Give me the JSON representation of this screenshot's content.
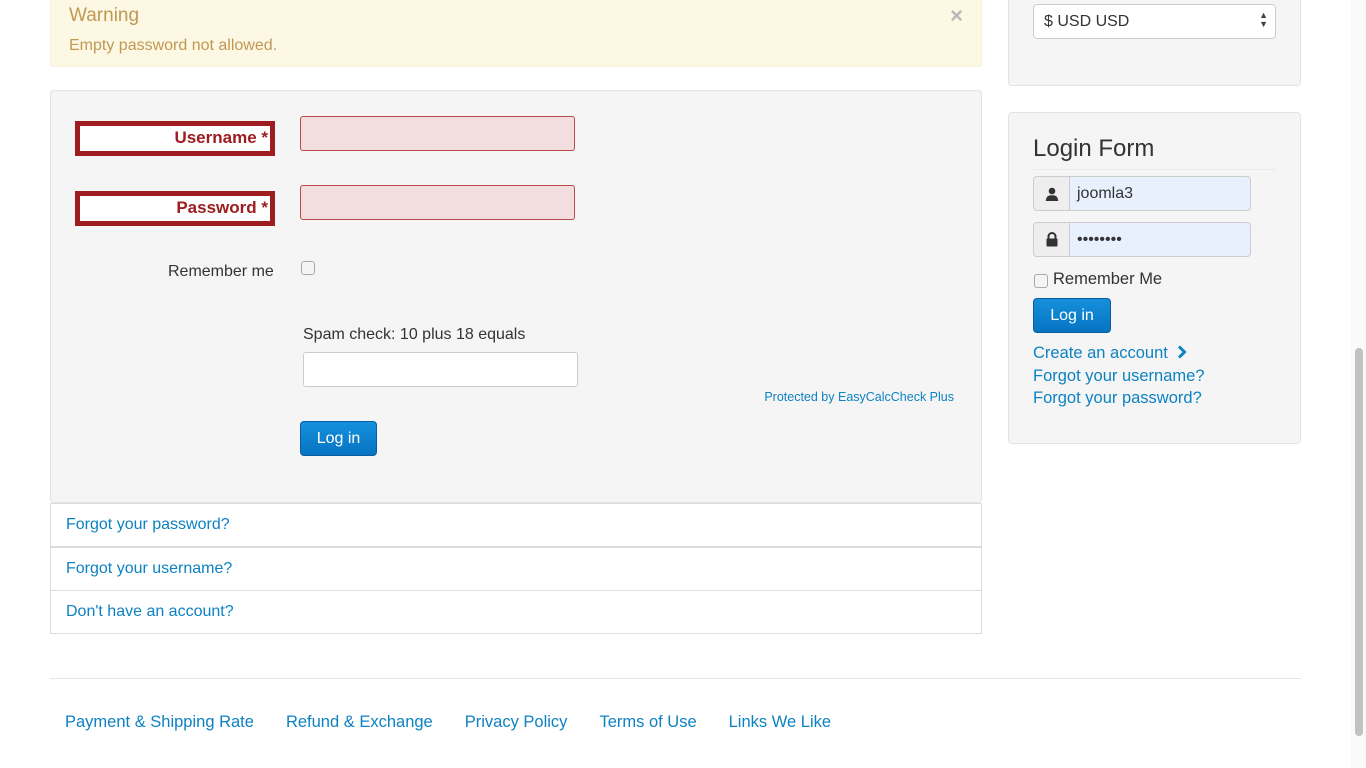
{
  "alert": {
    "heading": "Warning",
    "message": "Empty password not allowed.",
    "close": "×"
  },
  "login": {
    "username_label": "Username *",
    "password_label": "Password *",
    "username_value": "",
    "password_value": "",
    "remember_label": "Remember me",
    "spam_label": "Spam check: 10 plus 18 equals",
    "spam_value": "",
    "protected_by": "Protected by EasyCalcCheck Plus",
    "submit_label": "Log in"
  },
  "links": {
    "forgot_password": "Forgot your password?",
    "forgot_username": "Forgot your username?",
    "no_account": "Don't have an account?"
  },
  "footer": {
    "items": [
      {
        "label": "Payment & Shipping Rate"
      },
      {
        "label": "Refund & Exchange"
      },
      {
        "label": "Privacy Policy"
      },
      {
        "label": "Terms of Use"
      },
      {
        "label": "Links We Like"
      }
    ]
  },
  "sidebar": {
    "currency": {
      "selected": "$ USD USD"
    },
    "login_module": {
      "title": "Login Form",
      "username_value": "joomla3",
      "password_value": "••••••••",
      "remember_label": "Remember Me",
      "submit_label": "Log in",
      "create_account": "Create an account",
      "forgot_username": "Forgot your username?",
      "forgot_password": "Forgot your password?"
    }
  },
  "colors": {
    "link": "#0d82c2",
    "error": "#9d1d20",
    "warning_text": "#c09853",
    "warning_bg": "#fcf8e3",
    "primary_button": "#0b87d4"
  },
  "icons": {
    "close": "close-icon",
    "user": "user-icon",
    "lock": "lock-icon",
    "chevron": "chevron-right-icon",
    "select": "select-arrows-icon"
  }
}
